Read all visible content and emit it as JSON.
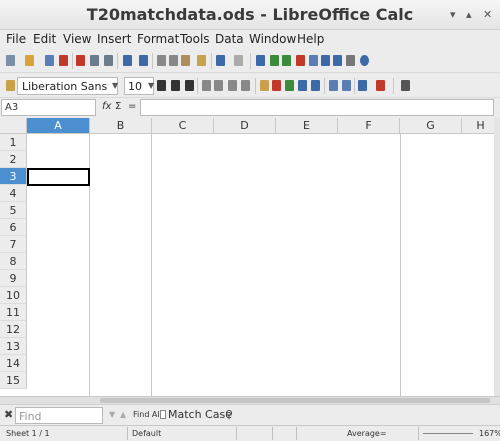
{
  "window": {
    "title": "T20matchdata.ods - LibreOffice Calc"
  },
  "menu": [
    "File",
    "Edit",
    "View",
    "Insert",
    "Format",
    "Tools",
    "Data",
    "Window",
    "Help"
  ],
  "format": {
    "font_name": "Liberation Sans",
    "font_size": "10"
  },
  "formula_bar": {
    "cell_ref": "A3",
    "fx": "fx",
    "sigma": "Σ",
    "equals": "="
  },
  "grid": {
    "columns": [
      "A",
      "B",
      "C",
      "D",
      "E",
      "F",
      "G",
      "H"
    ],
    "rows": [
      "1",
      "2",
      "3",
      "4",
      "5",
      "6",
      "7",
      "8",
      "9",
      "10",
      "11",
      "12",
      "13",
      "14",
      "15"
    ],
    "selected_cell": "A3"
  },
  "findbar": {
    "placeholder": "Find",
    "find_all": "Find All",
    "match_case": "Match Case"
  },
  "status": {
    "sheet": "Sheet 1 / 1",
    "style": "Default",
    "sum": "Average=",
    "zoom": "167%"
  },
  "colors": {
    "selection": "#4b8fd0"
  }
}
